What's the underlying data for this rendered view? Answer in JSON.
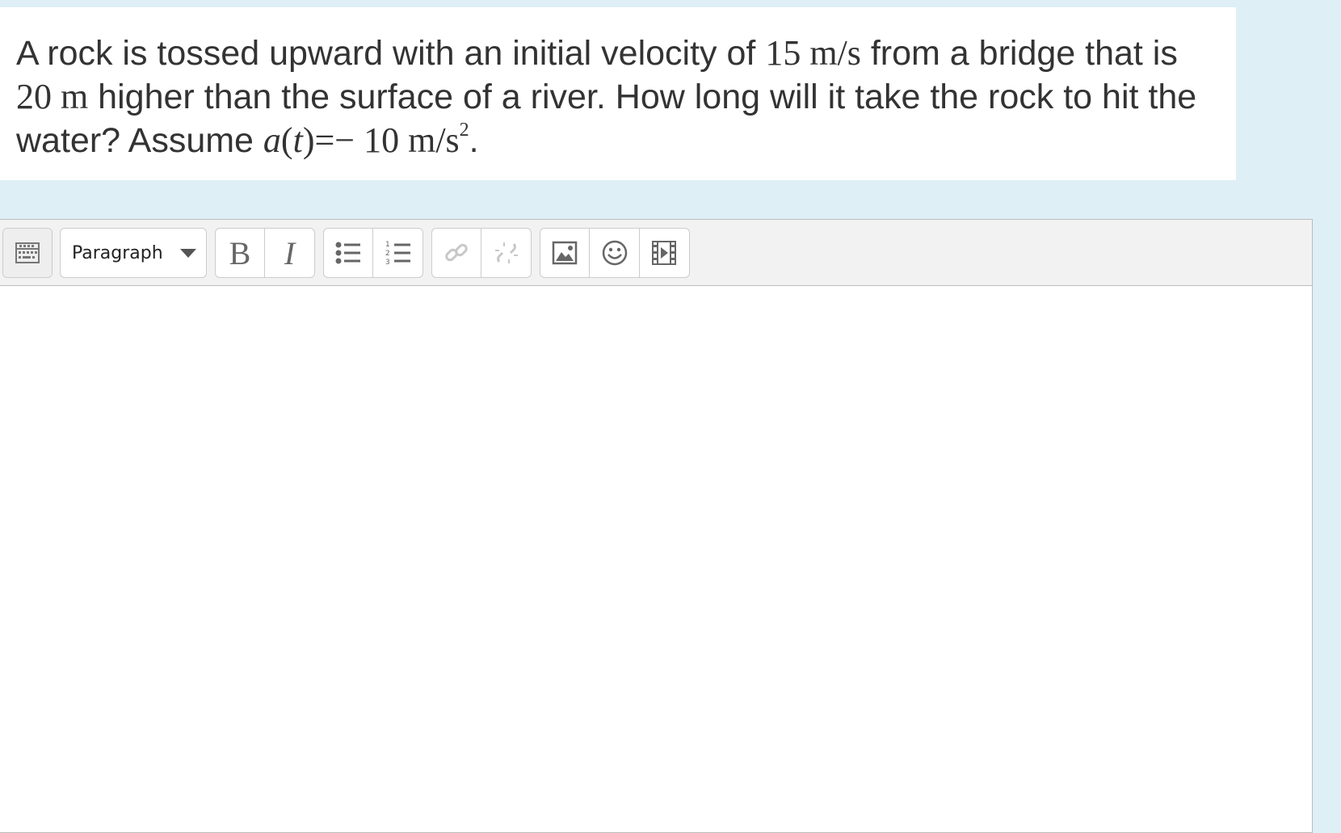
{
  "question": {
    "text_1": "A rock is tossed upward with an initial velocity of ",
    "math_1": "15 m/s",
    "text_2": " from a bridge that is ",
    "math_2": "20 m",
    "text_3": " higher than the surface of a river. How long will it take the rock to hit the water? Assume ",
    "math_3_a": "a",
    "math_3_paren_open": "(",
    "math_3_t": "t",
    "math_3_paren_close": ")",
    "math_3_rest": "=− 10 m/s",
    "math_3_sup": "2",
    "text_4": "."
  },
  "toolbar": {
    "format_select_value": "Paragraph",
    "bold_label": "B",
    "italic_label": "I"
  },
  "icons": {
    "toggle": "toolbar-toggle-icon",
    "bullet_list": "bullet-list-icon",
    "numbered_list": "numbered-list-icon",
    "link": "link-icon",
    "unlink": "unlink-icon",
    "image": "image-icon",
    "emoticon": "emoticon-icon",
    "media": "media-icon"
  },
  "colors": {
    "page_background": "#deeff6",
    "toolbar_background": "#f2f2f2",
    "icon_active": "#666666",
    "icon_disabled": "#c8c8c8"
  }
}
